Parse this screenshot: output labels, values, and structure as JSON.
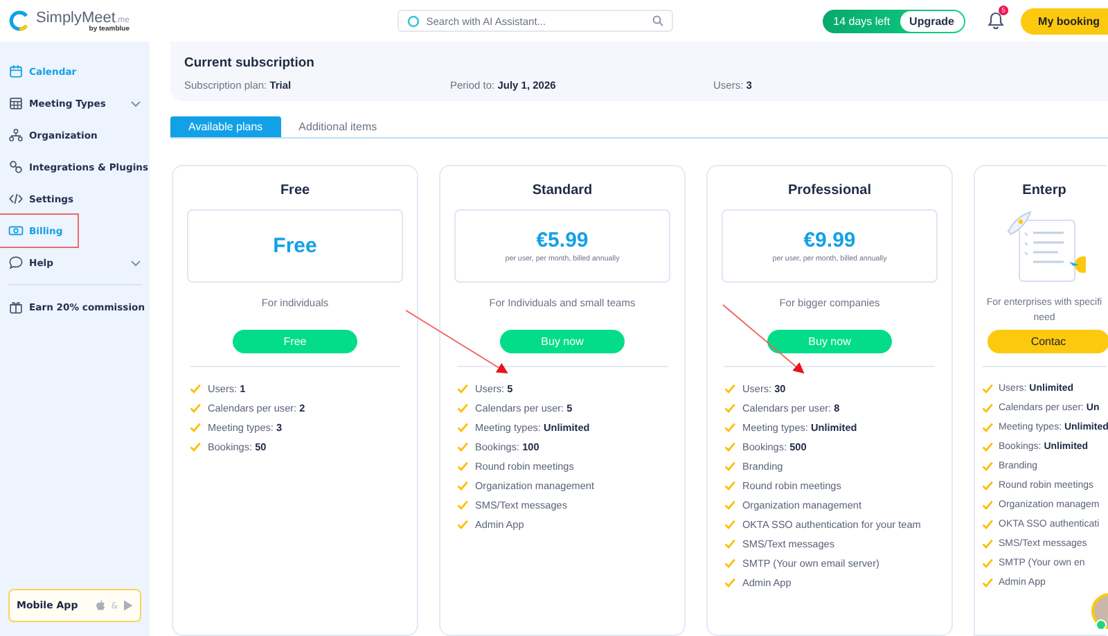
{
  "header": {
    "logo": {
      "name": "SimplyMeet",
      "suffix": ".me",
      "byline": "by teamblue"
    },
    "search": {
      "placeholder": "Search with AI Assistant..."
    },
    "trial": {
      "days_left": "14 days left",
      "upgrade": "Upgrade"
    },
    "notifications": {
      "count": "5"
    },
    "booking_button": "My booking"
  },
  "sidebar": {
    "items": [
      {
        "label": "Calendar",
        "selected": true,
        "expandable": false
      },
      {
        "label": "Meeting Types",
        "selected": false,
        "expandable": true
      },
      {
        "label": "Organization",
        "selected": false,
        "expandable": false
      },
      {
        "label": "Integrations & Plugins",
        "selected": false,
        "expandable": false
      },
      {
        "label": "Settings",
        "selected": false,
        "expandable": false
      },
      {
        "label": "Billing",
        "selected": true,
        "expandable": false
      },
      {
        "label": "Help",
        "selected": false,
        "expandable": true
      }
    ],
    "promo": "Earn 20% commission",
    "mobile_app": {
      "label": "Mobile App",
      "separator": "&"
    }
  },
  "subscription": {
    "title": "Current subscription",
    "fields": [
      {
        "label": "Subscription plan:",
        "value": "Trial"
      },
      {
        "label": "Period to:",
        "value": "July 1, 2026"
      },
      {
        "label": "Users:",
        "value": "3"
      }
    ]
  },
  "tabs": [
    {
      "label": "Available plans",
      "selected": true
    },
    {
      "label": "Additional items",
      "selected": false
    }
  ],
  "plans": [
    {
      "kind": "free",
      "name": "Free",
      "price": "Free",
      "description": "For individuals",
      "button": "Free",
      "features": [
        "Users: **1**",
        "Calendars per user: **2**",
        "Meeting types: **3**",
        "Bookings: **50**"
      ]
    },
    {
      "kind": "paid",
      "name": "Standard",
      "price": "€5.99",
      "price_note": "per user, per month, billed annually",
      "description": "For Individuals and small teams",
      "button": "Buy now",
      "features": [
        "Users: **5**",
        "Calendars per user: **5**",
        "Meeting types: **Unlimited**",
        "Bookings: **100**",
        "Round robin meetings",
        "Organization management",
        "SMS/Text messages",
        "Admin App"
      ]
    },
    {
      "kind": "paid",
      "name": "Professional",
      "price": "€9.99",
      "price_note": "per user, per month, billed annually",
      "description": "For bigger companies",
      "button": "Buy now",
      "features": [
        "Users: **30**",
        "Calendars per user: **8**",
        "Meeting types: **Unlimited**",
        "Bookings: **500**",
        "Branding",
        "Round robin meetings",
        "Organization management",
        "OKTA SSO authentication for your team",
        "SMS/Text messages",
        "SMTP (Your own email server)",
        "Admin App"
      ]
    },
    {
      "kind": "custom",
      "name": "Enterp",
      "description": "For enterprises with specifi\nneed",
      "button": "Contac",
      "features": [
        "Users: **Unlimited**",
        "Calendars per user: **Un**",
        "Meeting types: **Unlimited**",
        "Bookings: **Unlimited**",
        "Branding",
        "Round robin meetings",
        "Organization managem",
        "OKTA SSO authenticati",
        "SMS/Text messages",
        "SMTP (Your own en",
        "Admin App"
      ]
    }
  ]
}
